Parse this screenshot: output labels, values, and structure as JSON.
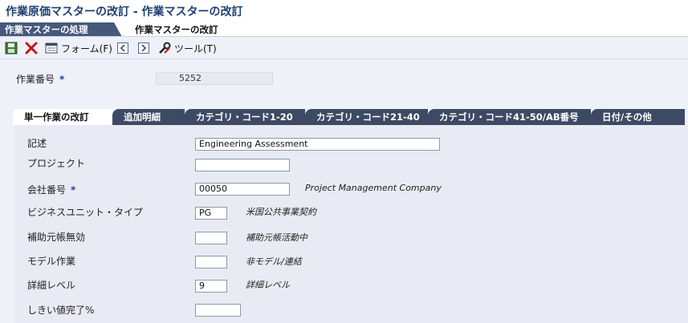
{
  "window": {
    "title": "作業原価マスターの改訂 - 作業マスターの改訂"
  },
  "breadcrumb": {
    "previous": "作業マスターの処理",
    "current": "作業マスターの改訂"
  },
  "toolbar": {
    "icons": [
      "save-icon",
      "cancel-icon",
      "form-icon",
      "prev-icon",
      "next-icon",
      "tools-icon"
    ],
    "form_label": "フォーム(F)",
    "tools_label": "ツール(T)"
  },
  "header": {
    "job_number_label": "作業番号",
    "required_mark": "*",
    "job_number_value": "5252"
  },
  "tabs": [
    {
      "label": "単一作業の改訂",
      "active": true
    },
    {
      "label": "追加明細",
      "active": false
    },
    {
      "label": "カテゴリ・コード1-20",
      "active": false
    },
    {
      "label": "カテゴリ・コード21-40",
      "active": false
    },
    {
      "label": "カテゴリ・コード41-50/AB番号",
      "active": false
    },
    {
      "label": "日付/その他",
      "active": false
    }
  ],
  "form": {
    "description": {
      "label": "記述",
      "value": "Engineering Assessment"
    },
    "project": {
      "label": "プロジェクト",
      "value": ""
    },
    "company": {
      "label": "会社番号",
      "required_mark": "*",
      "value": "00050",
      "desc": "Project Management Company"
    },
    "bu_type": {
      "label": "ビジネスユニット・タイプ",
      "value": "PG",
      "desc": "米国公共事業契約"
    },
    "subledger_inactive": {
      "label": "補助元帳無効",
      "value": "",
      "desc": "補助元帳活動中"
    },
    "model_job": {
      "label": "モデル作業",
      "value": "",
      "desc": "非モデル/連結"
    },
    "level_of_detail": {
      "label": "詳細レベル",
      "value": "9",
      "desc": "詳細レベル"
    },
    "threshold_pct": {
      "label": "しきい値完了%",
      "value": ""
    }
  },
  "colors": {
    "title": "#1e3f73",
    "tab_inactive": "#3d4a63",
    "nav_tab_inactive": "#46597a",
    "background": "#eef1f8",
    "required": "#1e3f9b",
    "cancel_red": "#cc1111"
  }
}
